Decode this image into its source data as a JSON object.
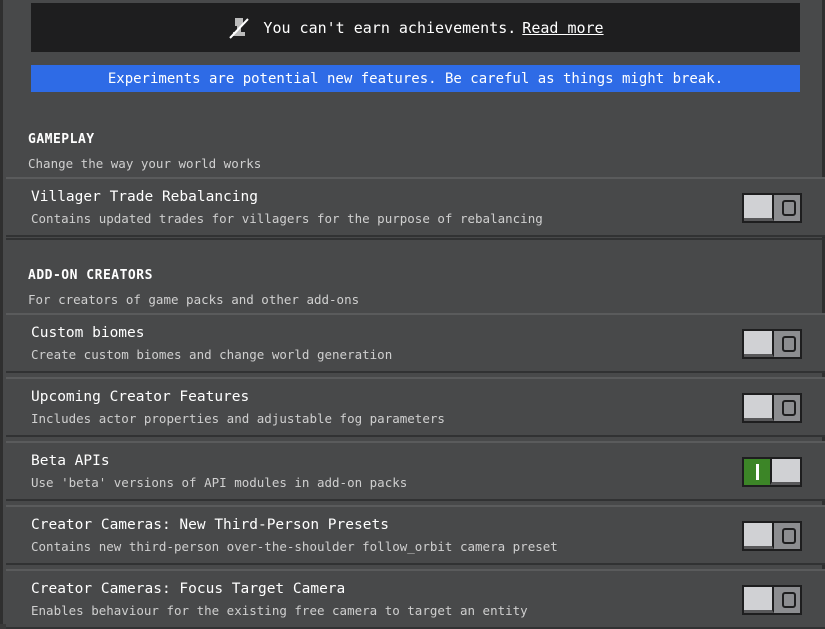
{
  "achievements_banner": {
    "text": "You can't earn achievements.",
    "link": "Read more",
    "icon": "crossed-trophy-icon"
  },
  "experiments_banner": {
    "text": "Experiments are potential new features. Be careful as things might break."
  },
  "sections": {
    "gameplay": {
      "title": "GAMEPLAY",
      "desc": "Change the way your world works"
    },
    "addon": {
      "title": "ADD-ON CREATORS",
      "desc": "For creators of game packs and other add-ons"
    }
  },
  "rows": [
    {
      "title": "Villager Trade Rebalancing",
      "desc": "Contains updated trades for villagers for the purpose of rebalancing",
      "enabled": false
    },
    {
      "title": "Custom biomes",
      "desc": "Create custom biomes and change world generation",
      "enabled": false
    },
    {
      "title": "Upcoming Creator Features",
      "desc": "Includes actor properties and adjustable fog parameters",
      "enabled": false
    },
    {
      "title": "Beta APIs",
      "desc": "Use 'beta' versions of API modules in add-on packs",
      "enabled": true
    },
    {
      "title": "Creator Cameras: New Third-Person Presets",
      "desc": "Contains new third-person over-the-shoulder follow_orbit camera preset",
      "enabled": false
    },
    {
      "title": "Creator Cameras: Focus Target Camera",
      "desc": "Enables behaviour for the existing free camera to target an entity",
      "enabled": false
    }
  ]
}
